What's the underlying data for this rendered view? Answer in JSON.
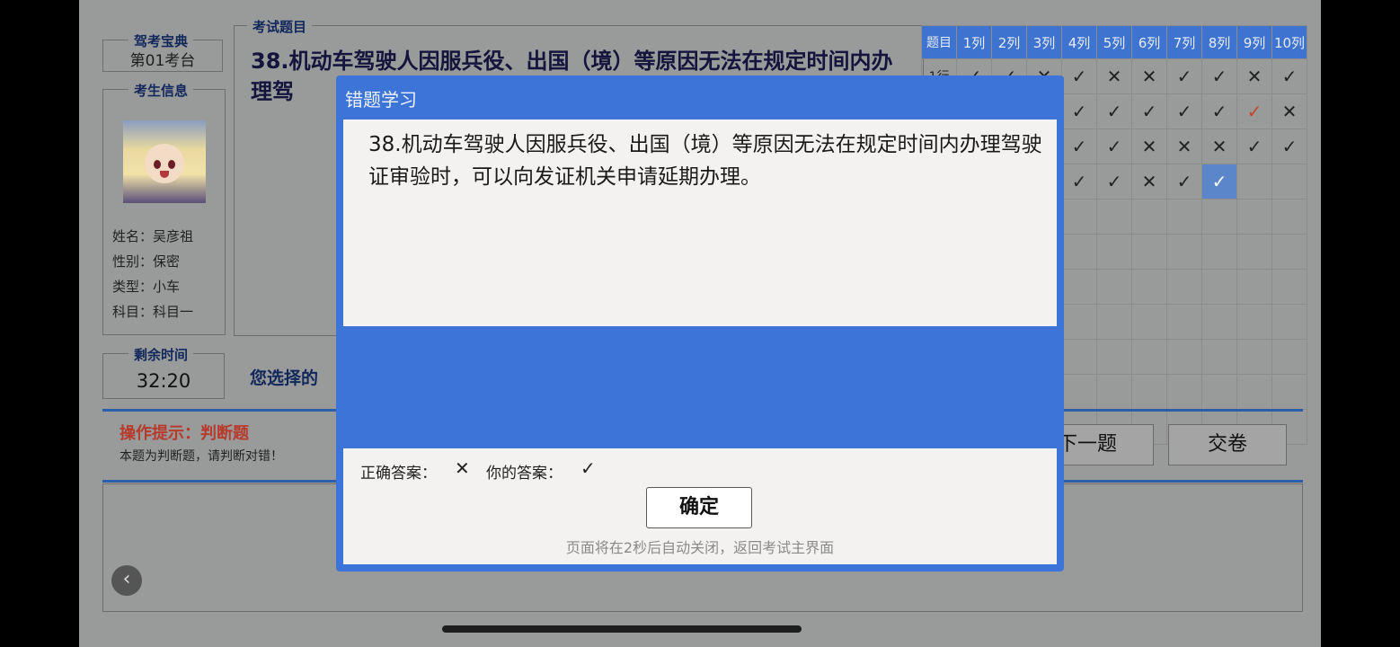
{
  "exam_station": {
    "legend": "驾考宝典",
    "value": "第01考台"
  },
  "student": {
    "legend": "考生信息",
    "name": "姓名：吴彦祖",
    "gender": "性别：保密",
    "type": "类型：小车",
    "subject": "科目一"
  },
  "timer": {
    "legend": "剩余时间",
    "value": "32:20"
  },
  "question": {
    "legend": "考试题目",
    "text": "38.机动车驾驶人因服兵役、出国（境）等原因无法在规定时间内办理驾"
  },
  "choose_label": "您选择的",
  "grid": {
    "header": [
      "题目",
      "1列",
      "2列",
      "3列",
      "4列",
      "5列",
      "6列",
      "7列",
      "8列",
      "9列",
      "10列"
    ],
    "row_labels": [
      "1行",
      "",
      "",
      "",
      "",
      "",
      "",
      "",
      "",
      "",
      ""
    ],
    "rows": [
      [
        "✓",
        "✓",
        "✕",
        "✓",
        "✕",
        "✕",
        "✓",
        "✓",
        "✕",
        "✓"
      ],
      [
        "",
        "",
        "",
        "✓",
        "✓",
        "✓",
        "✓",
        "✓",
        "✓",
        "✕"
      ],
      [
        "",
        "",
        "",
        "✓",
        "✓",
        "✕",
        "✕",
        "✕",
        "✓",
        "✓"
      ],
      [
        "",
        "",
        "",
        "✓",
        "✓",
        "✕",
        "✓",
        "✓",
        "",
        ""
      ],
      [
        "",
        "",
        "",
        "",
        "",
        "",
        "",
        "",
        "",
        ""
      ],
      [
        "",
        "",
        "",
        "",
        "",
        "",
        "",
        "",
        "",
        ""
      ],
      [
        "",
        "",
        "",
        "",
        "",
        "",
        "",
        "",
        "",
        ""
      ],
      [
        "",
        "",
        "",
        "",
        "",
        "",
        "",
        "",
        "",
        ""
      ],
      [
        "",
        "",
        "",
        "",
        "",
        "",
        "",
        "",
        "",
        ""
      ],
      [
        "",
        "",
        "",
        "",
        "",
        "",
        "",
        "",
        "",
        ""
      ],
      [
        "",
        "",
        "",
        "",
        "",
        "",
        "",
        "",
        "",
        ""
      ]
    ]
  },
  "hint": {
    "title": "操作提示：判断题",
    "subtitle": "本题为判断题，请判断对错！"
  },
  "buttons": {
    "next": "下一题",
    "submit": "交卷"
  },
  "modal": {
    "title": "错题学习",
    "body": "38.机动车驾驶人因服兵役、出国（境）等原因无法在规定时间内办理驾驶证审验时，可以向发证机关申请延期办理。",
    "correct_label": "正确答案：",
    "correct_value": "✕",
    "your_label": "你的答案：",
    "your_value": "✓",
    "ok": "确定",
    "auto_close": "页面将在2秒后自动关闭，返回考试主界面"
  },
  "colors": {
    "accent": "#3d74d8",
    "wrong": "#c8442c"
  }
}
